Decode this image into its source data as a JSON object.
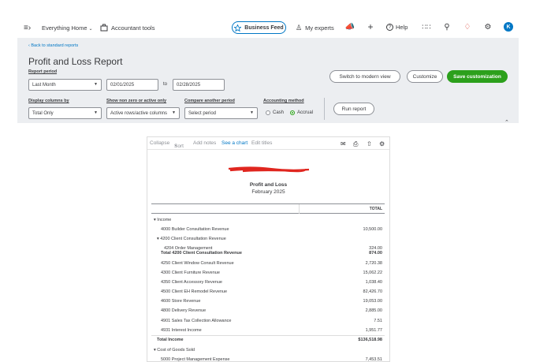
{
  "nav": {
    "company": "Everything Home",
    "accountant_tools": "Accountant tools",
    "business_feed": "Business Feed",
    "my_experts": "My experts",
    "help": "Help",
    "avatar_initial": "K"
  },
  "header": {
    "back_link": "Back to standard reports",
    "title": "Profit and Loss Report",
    "report_period_label": "Report period",
    "report_period": "Last Month",
    "date_from": "02/01/2025",
    "to_label": "to",
    "date_to": "02/28/2025",
    "display_columns_label": "Display columns by",
    "display_columns": "Total Only",
    "non_zero_label": "Show non zero or active only",
    "non_zero": "Active rows/active columns",
    "compare_label": "Compare another period",
    "compare": "Select period",
    "accounting_label": "Accounting method",
    "cash": "Cash",
    "accrual": "Accrual",
    "switch_btn": "Switch to modern view",
    "customize_btn": "Customize",
    "save_btn": "Save customization",
    "run_btn": "Run report"
  },
  "report_toolbar": {
    "collapse": "Collapse",
    "sort": "Sort",
    "add_notes": "Add notes",
    "see_chart": "See a chart",
    "edit_titles": "Edit titles"
  },
  "report": {
    "title": "Profit and Loss",
    "period": "February 2025",
    "total_header": "TOTAL",
    "rows": {
      "income": "Income",
      "r4000": {
        "name": "4000 Builder Consultation Revenue",
        "value": "10,500.00"
      },
      "r4200": "4200 Client Consultation Revenue",
      "r4204": {
        "name": "4204 Order Management",
        "value": "324.00"
      },
      "t4200": {
        "name": "Total 4200 Client Consultation Revenue",
        "value": "874.00"
      },
      "r4250": {
        "name": "4250 Client Window Consult Revenue",
        "value": "2,720.38"
      },
      "r4300": {
        "name": "4300 Client Furniture Revenue",
        "value": "15,062.22"
      },
      "r4350": {
        "name": "4350 Client Accessory Revenue",
        "value": "1,038.40"
      },
      "r4500": {
        "name": "4500 Client EH Remodel Revenue",
        "value": "82,426.70"
      },
      "r4600": {
        "name": "4600 Store Revenue",
        "value": "19,053.00"
      },
      "r4800": {
        "name": "4800 Delivery Revenue",
        "value": "2,885.00"
      },
      "r4901": {
        "name": "4901 Sales Tax Collection Allowance",
        "value": "7.51"
      },
      "r4931": {
        "name": "4931 Interest Income",
        "value": "1,951.77"
      },
      "total_income": {
        "name": "Total Income",
        "value": "$136,518.98"
      },
      "cogs": "Cost of Goods Sold",
      "r5000": {
        "name": "5000 Project Management Expense",
        "value": "7,453.51"
      }
    }
  }
}
